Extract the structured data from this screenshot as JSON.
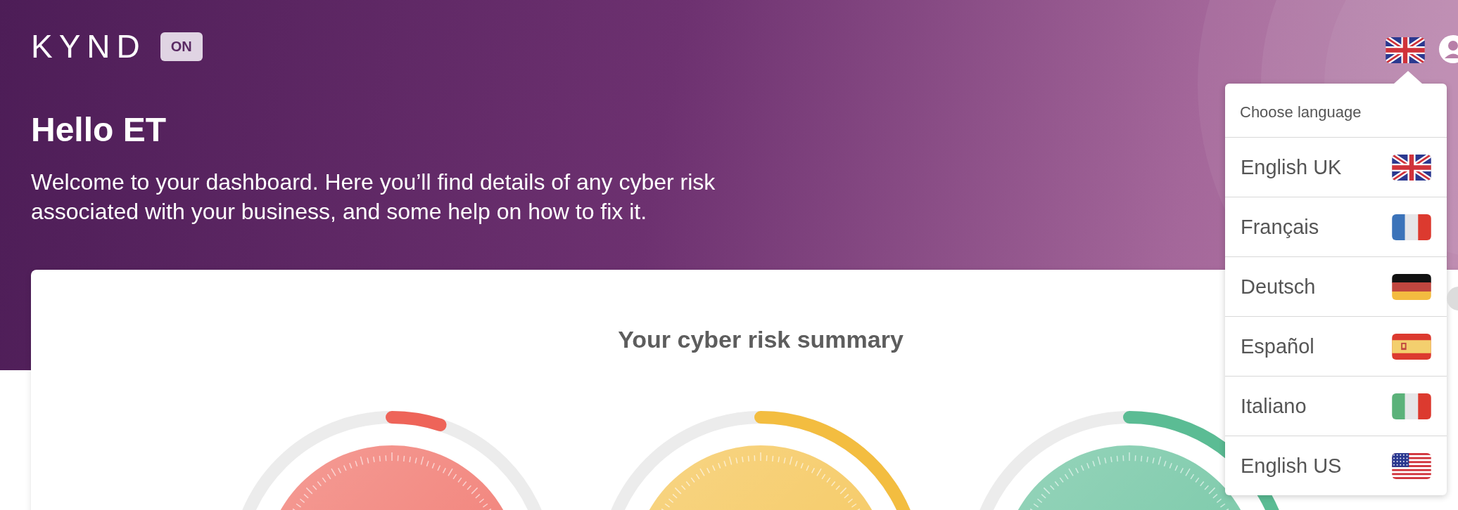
{
  "brand": {
    "logo": "KYND",
    "badge": "ON"
  },
  "language_button": {
    "kind": "uk"
  },
  "header": {
    "greeting": "Hello ET",
    "intro": "Welcome to your dashboard. Here you’ll find details of any cyber risk associated with your business, and some help on how to fix it."
  },
  "summary": {
    "title": "Your cyber risk summary",
    "gauges": [
      {
        "color": "#ee6459"
      },
      {
        "color": "#f3bd40"
      },
      {
        "color": "#5bbc94"
      }
    ]
  },
  "language_menu": {
    "title": "Choose language",
    "items": [
      {
        "label": "English UK",
        "kind": "uk"
      },
      {
        "label": "Français",
        "kind": "fr"
      },
      {
        "label": "Deutsch",
        "kind": "de"
      },
      {
        "label": "Español",
        "kind": "es"
      },
      {
        "label": "Italiano",
        "kind": "it"
      },
      {
        "label": "English US",
        "kind": "us"
      }
    ]
  }
}
